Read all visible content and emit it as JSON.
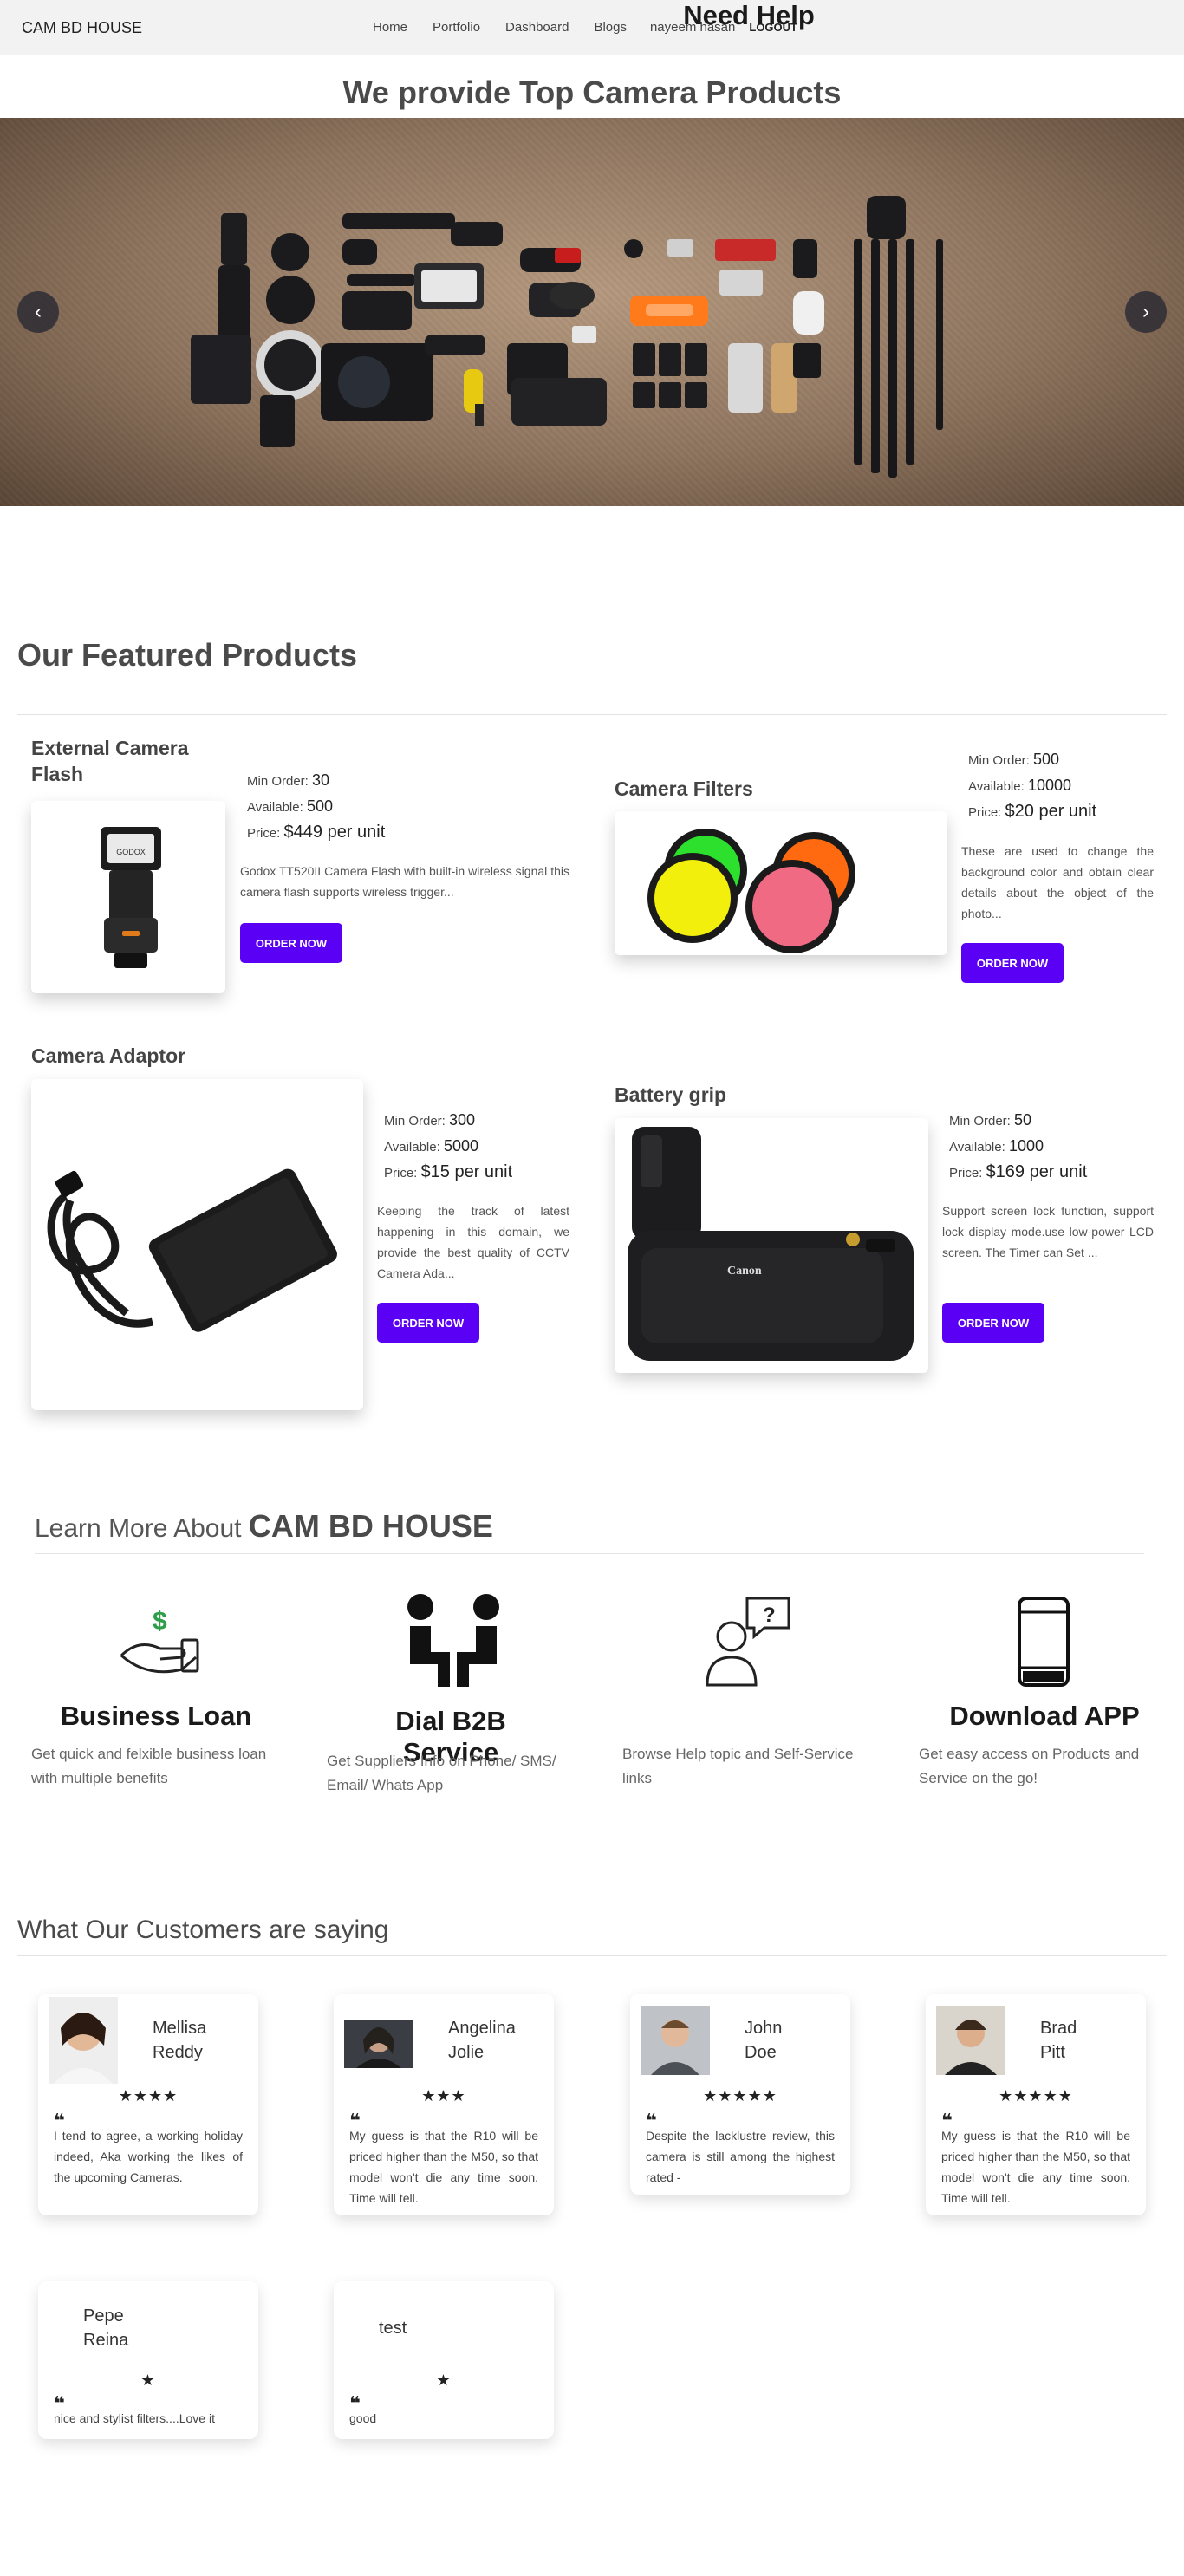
{
  "nav": {
    "brand": "CAM BD HOUSE",
    "links": [
      "Home",
      "Portfolio",
      "Dashboard",
      "Blogs"
    ],
    "user": "nayeem hasan",
    "logout": "LOGOUT"
  },
  "hero": {
    "title": "We provide Top Camera Products",
    "prev": "‹",
    "next": "›"
  },
  "featured": {
    "title": "Our Featured Products",
    "min_order_label": "Min Order:",
    "available_label": "Available:",
    "price_label": "Price:",
    "order_button": "ORDER NOW",
    "products": [
      {
        "name": "External Camera Flash",
        "min_order": "30",
        "available": "500",
        "price": "$449 per unit",
        "description": "Godox TT520II Camera Flash with built-in wireless signal this camera flash supports wireless trigger..."
      },
      {
        "name": "Camera Filters",
        "min_order": "500",
        "available": "10000",
        "price": "$20 per unit",
        "description": "These are used to change the background color and obtain clear details about the object of the photo..."
      },
      {
        "name": "Camera Adaptor",
        "min_order": "300",
        "available": "5000",
        "price": "$15 per unit",
        "description": "Keeping the track of latest happening in this domain, we provide the best quality of CCTV Camera Ada..."
      },
      {
        "name": "Battery grip",
        "min_order": "50",
        "available": "1000",
        "price": "$169 per unit",
        "description": "Support screen lock function, support lock display mode.use low-power LCD screen. The Timer can Set ..."
      }
    ],
    "grip_logo": "Canon",
    "flash_logo": "GODOX"
  },
  "learn": {
    "prefix": "Learn More About",
    "brand": "CAM BD HOUSE",
    "services": [
      {
        "title": "Business Loan",
        "description": "Get quick and felxible business loan with multiple benefits",
        "icon": "loan-hand-icon"
      },
      {
        "title": "Dial B2B Service",
        "description": "Get Suppliers Info on Phone/ SMS/ Email/ Whats App",
        "icon": "people-icon"
      },
      {
        "title": "Need Help",
        "description": "Browse Help topic and Self-Service links",
        "icon": "help-person-icon"
      },
      {
        "title": "Download APP",
        "description": "Get easy access on Products and Service on the go!",
        "icon": "phone-icon"
      }
    ],
    "loan_symbol": "$",
    "help_symbol": "?"
  },
  "testimonials": {
    "title": "What Our Customers are saying",
    "quote_mark": "❝",
    "items": [
      {
        "first": "Mellisa",
        "last": "Reddy",
        "stars": "★★★★",
        "text": "I tend to agree, a working holiday indeed, Aka working the likes of the upcoming Cameras."
      },
      {
        "first": "Angelina",
        "last": "Jolie",
        "stars": "★★★",
        "text": "My guess is that the R10 will be priced higher than the M50, so that model won't die any time soon. Time will tell."
      },
      {
        "first": "John",
        "last": "Doe",
        "stars": "★★★★★",
        "text": "Despite the lacklustre review, this camera is still among the highest rated -"
      },
      {
        "first": "Brad",
        "last": "Pitt",
        "stars": "★★★★★",
        "text": "My guess is that the R10 will be priced higher than the M50, so that model won't die any time soon. Time will tell."
      },
      {
        "first": "Pepe",
        "last": "Reina",
        "stars": "★",
        "text": "nice and stylist filters....Love it"
      },
      {
        "first": "test",
        "last": "",
        "stars": "★",
        "text": "good"
      }
    ]
  },
  "colors": {
    "accent": "#5a00f5",
    "nav_bg": "#f2f2f2"
  }
}
